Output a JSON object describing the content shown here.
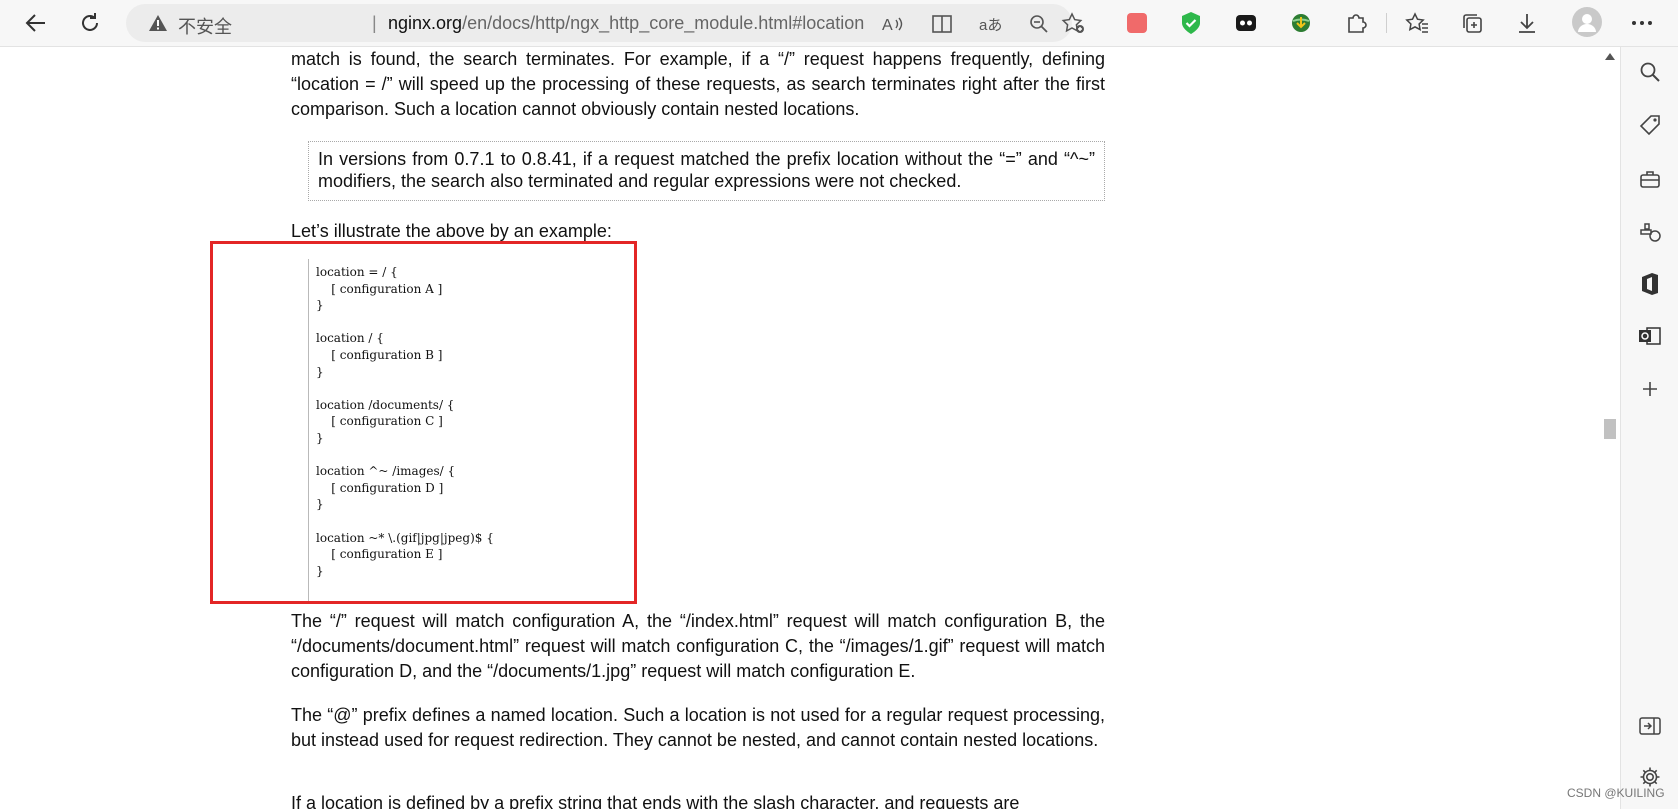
{
  "browser": {
    "security_label": "不安全",
    "separator": "|",
    "url_host": "nginx.org",
    "url_path": "/en/docs/http/ngx_http_core_module.html#location"
  },
  "content": {
    "para1": "match is found, the search terminates. For example, if a “/” request happens frequently, defining “location = /” will speed up the processing of these requests, as search terminates right after the first comparison. Such a location cannot obviously contain nested locations.",
    "note": "In versions from 0.7.1 to 0.8.41, if a request matched the prefix location without the “=” and “^~” modifiers, the search also terminated and regular expressions were not checked.",
    "example_intro": "Let’s illustrate the above by an example:",
    "code_example": "location = / {\n    [ configuration A ]\n}\n\nlocation / {\n    [ configuration B ]\n}\n\nlocation /documents/ {\n    [ configuration C ]\n}\n\nlocation ^~ /images/ {\n    [ configuration D ]\n}\n\nlocation ~* \\.(gif|jpg|jpeg)$ {\n    [ configuration E ]\n}",
    "para2": "The “/” request will match configuration A, the “/index.html” request will match configuration B, the “/documents/document.html” request will match configuration C, the “/images/1.gif” request will match configuration D, and the “/documents/1.jpg” request will match configuration E.",
    "para3": "The “@” prefix defines a named location. Such a location is not used for a regular request processing, but instead used for request redirection. They cannot be nested, and cannot contain nested locations.",
    "para4": "If a location is defined by a prefix string that ends with the slash character, and requests are"
  },
  "watermark": "CSDN @KUILING"
}
